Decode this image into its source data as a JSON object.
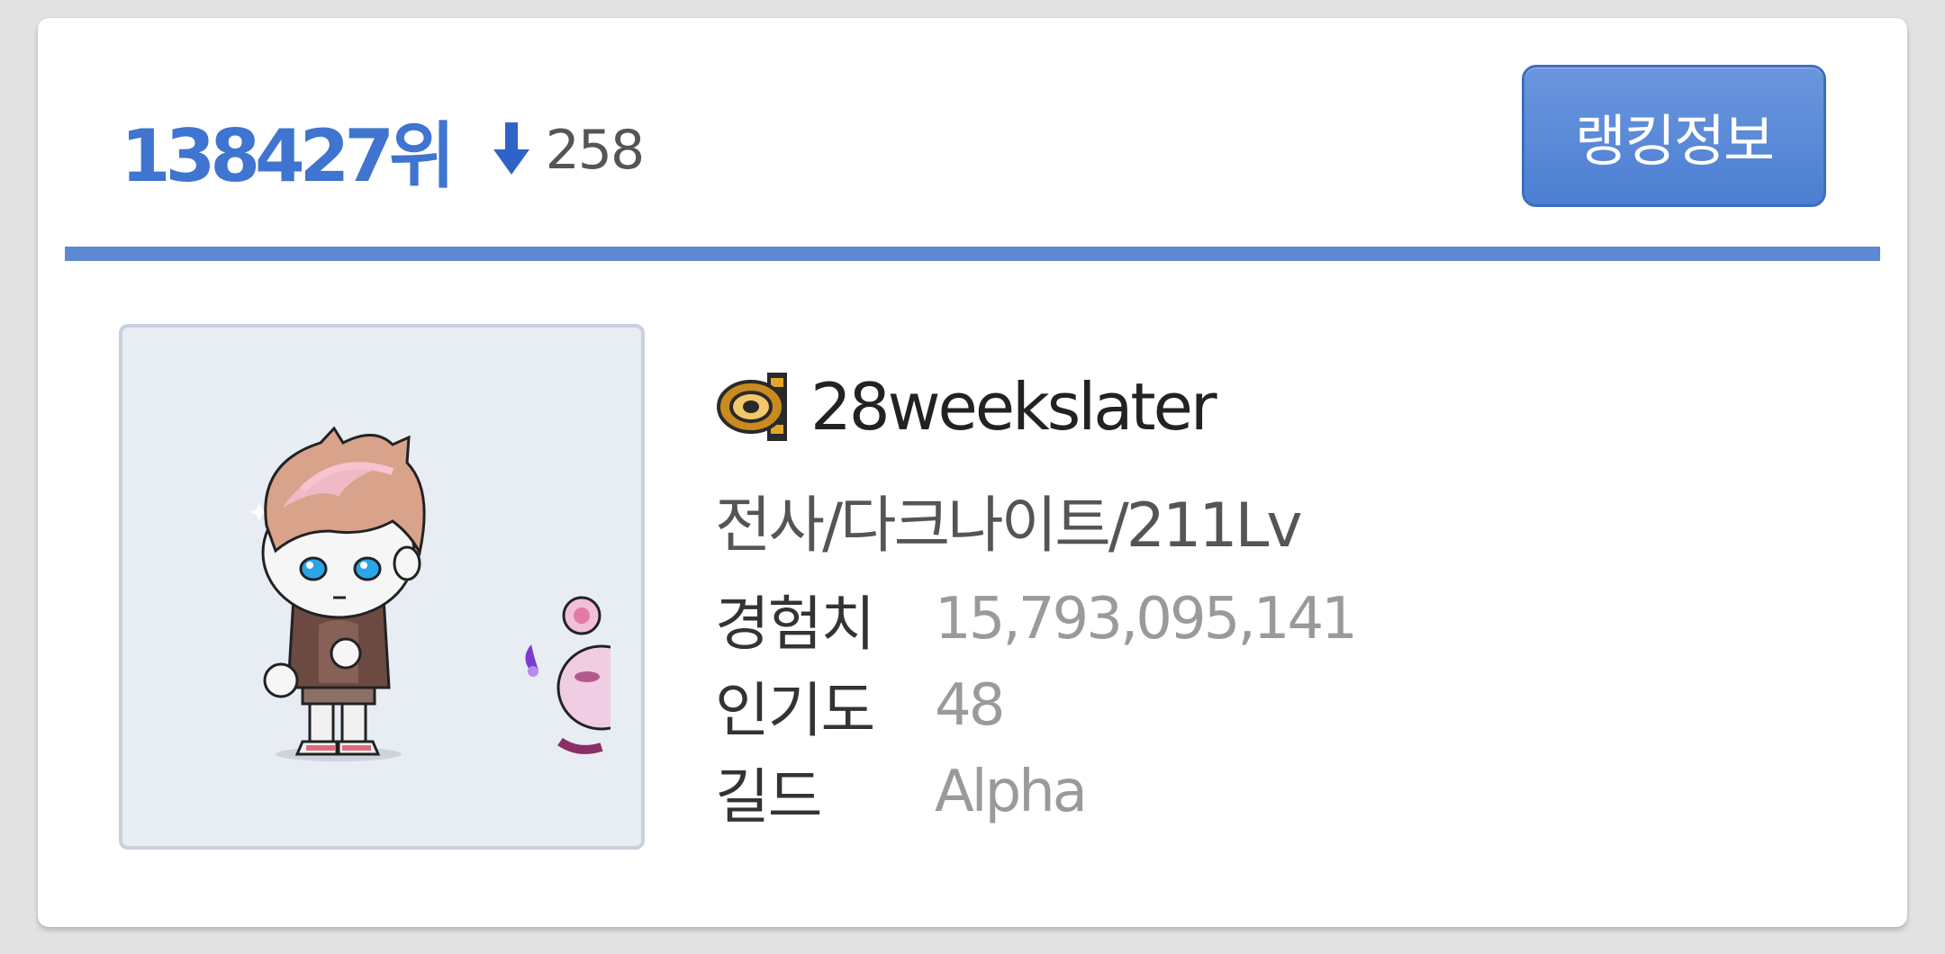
{
  "ranking": {
    "rank_text": "138427위",
    "change_direction": "down",
    "change_value": "258",
    "rank_info_button_label": "랭킹정보"
  },
  "character": {
    "name": "28weekslater",
    "job_line": "전사/다크나이트/211Lv",
    "guild_emblem_icon": "guild-emblem-icon",
    "stats": [
      {
        "label": "경험치",
        "value": "15,793,095,141"
      },
      {
        "label": "인기도",
        "value": "48"
      },
      {
        "label": "길드",
        "value": "Alpha"
      }
    ]
  },
  "colors": {
    "accent": "#3f74d0",
    "button": "#5b8ad8",
    "divider": "#5e88d3",
    "avatar_bg": "#e8ecf3",
    "value_text": "#9a9a9a"
  }
}
